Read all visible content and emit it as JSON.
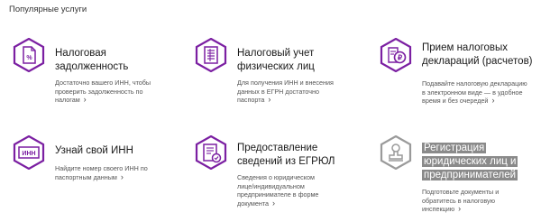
{
  "section": {
    "title": "Популярные услуги"
  },
  "services": [
    {
      "title_lines": [
        "Налоговая",
        "задолженность"
      ],
      "desc_lines": [
        "Достаточно вашего ИНН, чтобы",
        "проверить задолженность по",
        "налогам"
      ],
      "icon": "tax-debt-document-icon"
    },
    {
      "title_lines": [
        "Налоговый учет",
        "физических лиц"
      ],
      "desc_lines": [
        "Для получения ИНН и внесения",
        "данных в ЕГРН достаточно",
        "паспорта"
      ],
      "icon": "registry-document-icon"
    },
    {
      "title_lines": [
        "Прием налоговых",
        "деклараций (расчетов)"
      ],
      "desc_lines": [
        "Подавайте налоговую декларацию",
        "в электронном виде — в удобное",
        "время и без очередей"
      ],
      "icon": "declaration-ruble-icon"
    },
    {
      "title_lines": [
        "Узнай свой ИНН"
      ],
      "desc_lines": [
        "Найдите номер своего ИНН по",
        "паспортным данным"
      ],
      "icon": "inn-card-icon",
      "icon_text": "ИНН"
    },
    {
      "title_lines": [
        "Предоставление",
        "сведений из ЕГРЮЛ"
      ],
      "desc_lines": [
        "Сведения о юридическом",
        "лице/индивидуальном",
        "предпринимателе в форме",
        "документа"
      ],
      "icon": "egrul-certificate-icon"
    },
    {
      "title_lines": [
        "Регистрация",
        "юридических лиц и",
        "предпринимателей"
      ],
      "desc_lines": [
        "Подготовьте документы и",
        "обратитесь в налоговую",
        "инспекцию"
      ],
      "icon": "stamp-icon"
    }
  ],
  "colors": {
    "accent": "#7b1fa2",
    "muted_icon": "#9a9a9a"
  },
  "arrow_glyph": "›"
}
